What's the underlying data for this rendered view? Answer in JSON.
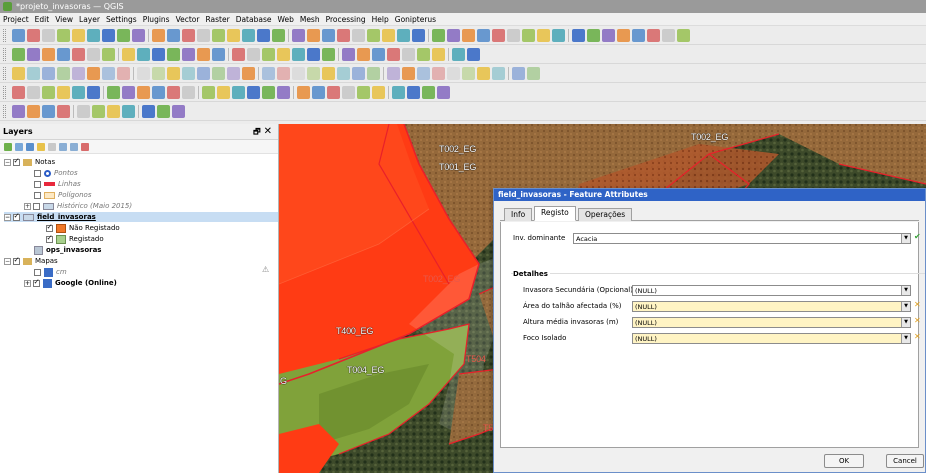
{
  "window": {
    "title": "*projeto_invasoras — QGIS"
  },
  "menu": [
    "Project",
    "Edit",
    "View",
    "Layer",
    "Settings",
    "Plugins",
    "Vector",
    "Raster",
    "Database",
    "Web",
    "Mesh",
    "Processing",
    "Help",
    "Gonipterus"
  ],
  "layers_panel": {
    "title": "Layers",
    "close_glyph": "✕",
    "float_glyph": "🗗",
    "tree": [
      {
        "label": "Notas",
        "style": "group"
      },
      {
        "label": "Pontos",
        "style": "italic"
      },
      {
        "label": "Linhas",
        "style": "italic"
      },
      {
        "label": "Polígonos",
        "style": "italic"
      },
      {
        "label": "Histórico (Maio 2015)",
        "style": "italic"
      },
      {
        "label": "field_invasoras",
        "style": "bold"
      },
      {
        "label": "Não Registado",
        "style": "normal"
      },
      {
        "label": "Registado",
        "style": "normal"
      },
      {
        "label": "ops_invasoras",
        "style": "bold"
      },
      {
        "label": "Mapas",
        "style": "group"
      },
      {
        "label": "cm",
        "style": "italic"
      },
      {
        "label": "Google (Online)",
        "style": "bold"
      }
    ]
  },
  "map": {
    "labels": [
      {
        "text": "T002_EG",
        "style": "white"
      },
      {
        "text": "T002_EG",
        "style": "white"
      },
      {
        "text": "T001_EG",
        "style": "white"
      },
      {
        "text": "T002_EG",
        "style": "red"
      },
      {
        "text": "T400_EG",
        "style": "white"
      },
      {
        "text": "T004_EG",
        "style": "white"
      },
      {
        "text": "T504",
        "style": "red"
      },
      {
        "text": "T5",
        "style": "red"
      },
      {
        "text": "G",
        "style": "white"
      }
    ]
  },
  "dialog": {
    "title": "field_invasoras - Feature Attributes",
    "tabs": [
      "Info",
      "Registo",
      "Operações"
    ],
    "active_tab": "Registo",
    "main_field": {
      "label": "Inv. dominante",
      "value": "Acacia"
    },
    "group_title": "Detalhes",
    "fields": [
      {
        "label": "Invasora Secundária (Opcional)",
        "value": "(NULL)",
        "highlight": false
      },
      {
        "label": "Área do talhão afectada (%)",
        "value": "(NULL)",
        "highlight": true
      },
      {
        "label": "Altura média invasoras (m)",
        "value": "(NULL)",
        "highlight": true
      },
      {
        "label": "Foco Isolado",
        "value": "(NULL)",
        "highlight": true
      }
    ],
    "ok_label": "OK",
    "cancel_label": "Cancel"
  },
  "colors": {
    "titlebar": "#9a9a9a",
    "dialog_title": "#2f63c6",
    "layer_nao_registado": "#f07828",
    "layer_registado": "#a8d08d",
    "linhas_symbol": "#e8283c",
    "map_red_fill": "#ff3b14",
    "map_outline": "#e8202a"
  }
}
